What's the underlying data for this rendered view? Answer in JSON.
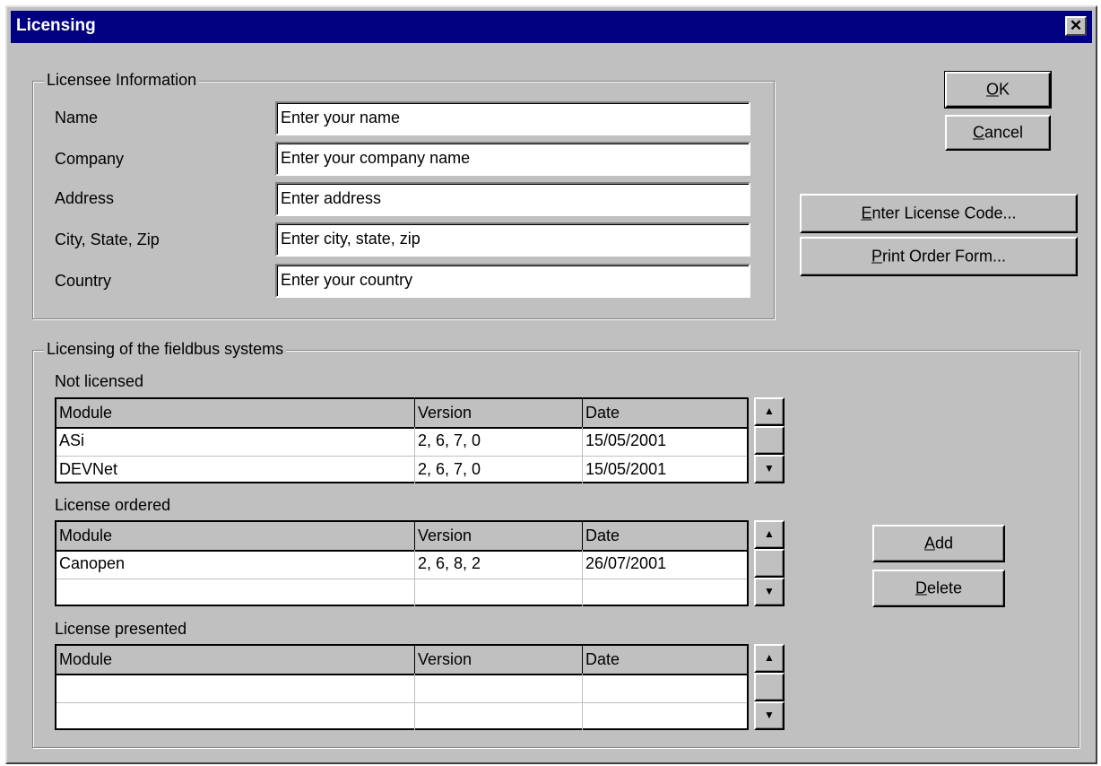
{
  "window": {
    "title": "Licensing",
    "close_glyph": "✕"
  },
  "licensee": {
    "group_label": "Licensee Information",
    "fields": [
      {
        "label": "Name",
        "value": "Enter your name"
      },
      {
        "label": "Company",
        "value": "Enter your company name"
      },
      {
        "label": "Address",
        "value": "Enter address"
      },
      {
        "label": "City, State, Zip",
        "value": "Enter city, state, zip"
      },
      {
        "label": "Country",
        "value": "Enter your country"
      }
    ]
  },
  "buttons": {
    "ok": {
      "u": "O",
      "rest": "K"
    },
    "cancel": {
      "u": "C",
      "rest": "ancel"
    },
    "enter_code": {
      "u": "E",
      "rest": "nter License Code..."
    },
    "print_form": {
      "u": "P",
      "rest": "rint Order Form..."
    },
    "add": {
      "u": "A",
      "rest": "dd"
    },
    "delete": {
      "u": "D",
      "rest": "elete"
    }
  },
  "fieldbus": {
    "group_label": "Licensing of the fieldbus systems",
    "columns": [
      "Module",
      "Version",
      "Date"
    ],
    "not_licensed": {
      "label": "Not licensed",
      "rows": [
        [
          "ASi",
          "2, 6, 7, 0",
          "15/05/2001"
        ],
        [
          "DEVNet",
          "2, 6, 7, 0",
          "15/05/2001"
        ]
      ]
    },
    "ordered": {
      "label": "License ordered",
      "rows": [
        [
          "Canopen",
          "2, 6, 8, 2",
          "26/07/2001"
        ],
        [
          "",
          "",
          ""
        ]
      ]
    },
    "presented": {
      "label": "License presented",
      "rows": [
        [
          "",
          "",
          ""
        ],
        [
          "",
          "",
          ""
        ]
      ]
    }
  },
  "scroll": {
    "up_glyph": "▲",
    "down_glyph": "▼"
  }
}
